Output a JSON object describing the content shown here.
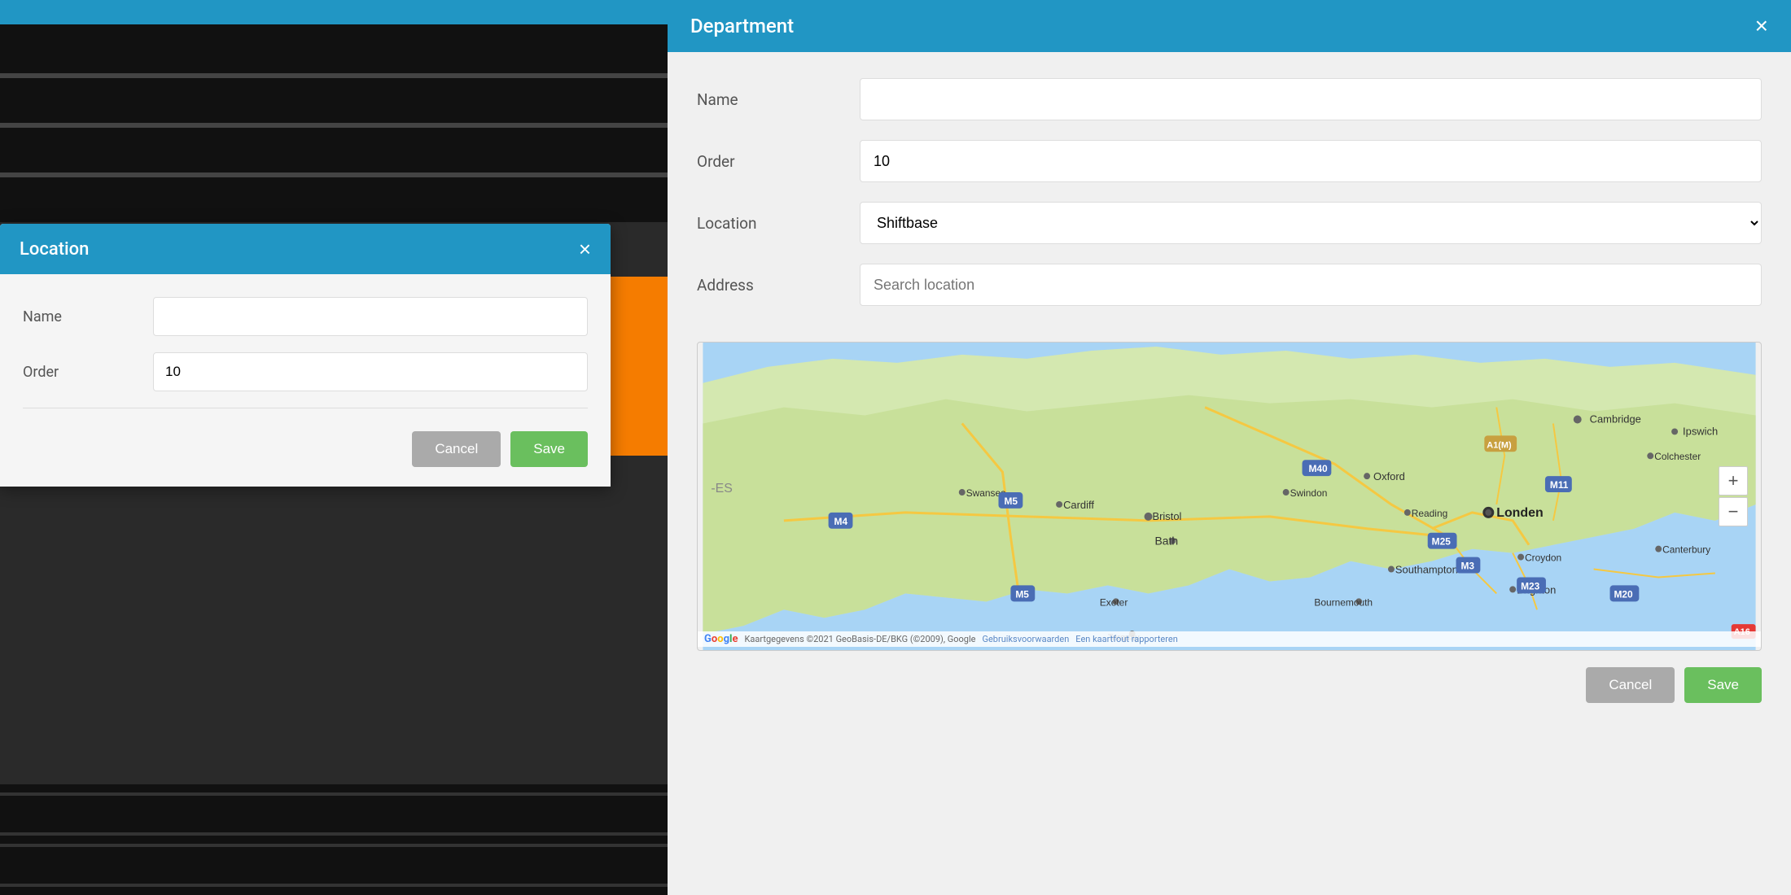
{
  "app": {
    "title_left": "Location",
    "title_right": "Department"
  },
  "location_modal": {
    "title": "Location",
    "close_label": "×",
    "name_label": "Name",
    "name_value": "",
    "name_placeholder": "",
    "order_label": "Order",
    "order_value": "10",
    "cancel_label": "Cancel",
    "save_label": "Save"
  },
  "department_modal": {
    "title": "Department",
    "close_label": "×",
    "name_label": "Name",
    "name_value": "",
    "name_placeholder": "",
    "order_label": "Order",
    "order_value": "10",
    "location_label": "Location",
    "location_value": "Shiftbase",
    "location_options": [
      "Shiftbase"
    ],
    "address_label": "Address",
    "address_placeholder": "Search location",
    "cancel_label": "Cancel",
    "save_label": "Save"
  },
  "map": {
    "attribution": "Kaartgegevens ©2021 GeoBasis-DE/BKG (©2009), Google",
    "terms": "Gebruiksvoorwaarden",
    "report": "Een kaartfout rapporteren",
    "zoom_in": "+",
    "zoom_out": "−",
    "city_bath": "Bath"
  }
}
